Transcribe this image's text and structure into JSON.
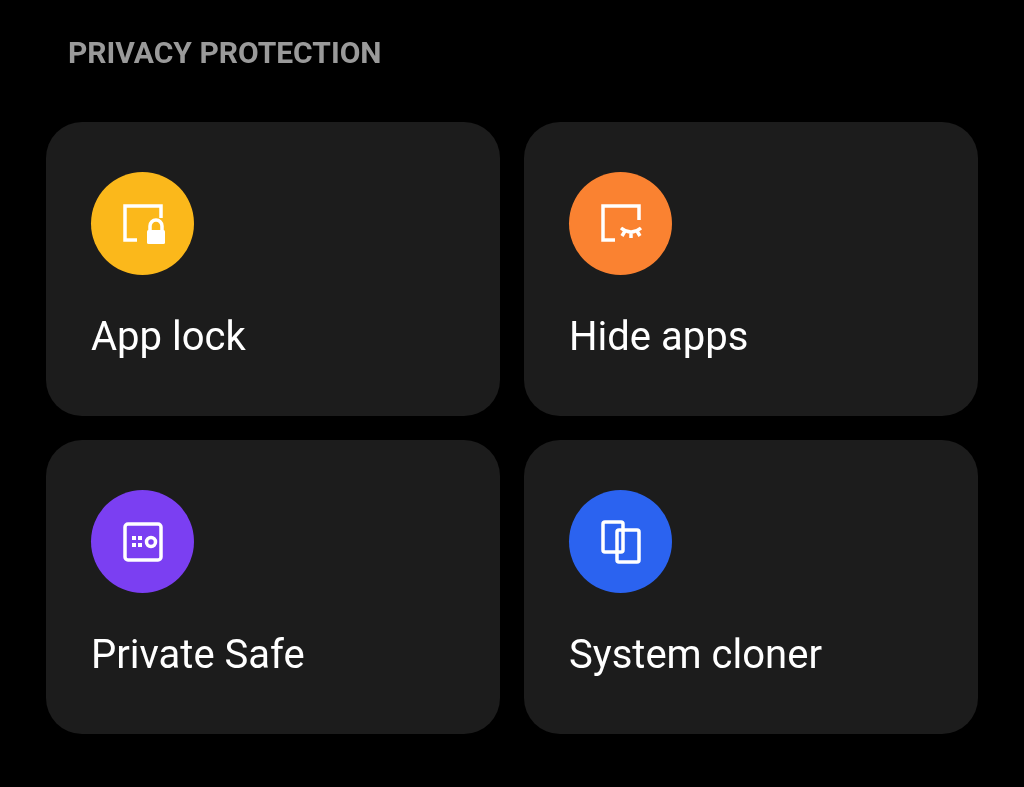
{
  "section": {
    "title": "PRIVACY PROTECTION"
  },
  "tiles": [
    {
      "label": "App lock",
      "kind": "lock",
      "color": "#fbb81b"
    },
    {
      "label": "Hide apps",
      "kind": "hide",
      "color": "#fa8231"
    },
    {
      "label": "Private Safe",
      "kind": "safe",
      "color": "#7b3ff2"
    },
    {
      "label": "System cloner",
      "kind": "clone",
      "color": "#2b63f0"
    }
  ]
}
